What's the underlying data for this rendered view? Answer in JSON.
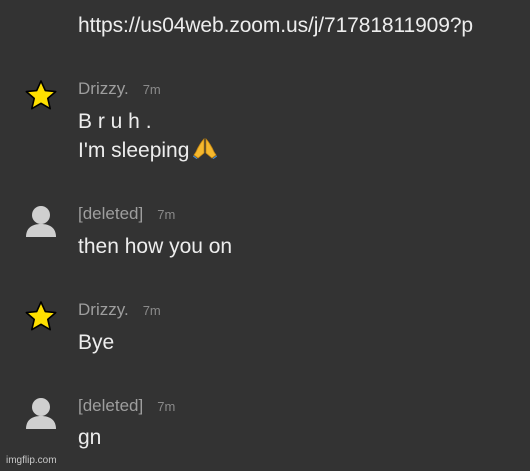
{
  "link": {
    "url": "https://us04web.zoom.us/j/71781811909?p"
  },
  "messages": [
    {
      "author": "Drizzy.",
      "avatar_icon": "star-icon",
      "time": "7m",
      "lines": [
        "B r u h .",
        "I'm sleeping"
      ],
      "emoji": "folded-hands-icon"
    },
    {
      "author": "[deleted]",
      "avatar_icon": "default-user-icon",
      "time": "7m",
      "lines": [
        "then how you on"
      ]
    },
    {
      "author": "Drizzy.",
      "avatar_icon": "star-icon",
      "time": "7m",
      "lines": [
        "Bye"
      ]
    },
    {
      "author": "[deleted]",
      "avatar_icon": "default-user-icon",
      "time": "7m",
      "lines": [
        "gn"
      ]
    }
  ],
  "watermark": "imgflip.com",
  "colors": {
    "background": "#333333",
    "text": "#ededed",
    "meta": "#9e9e9e",
    "star": "#ffe000",
    "default_avatar": "#cfcfcf"
  }
}
